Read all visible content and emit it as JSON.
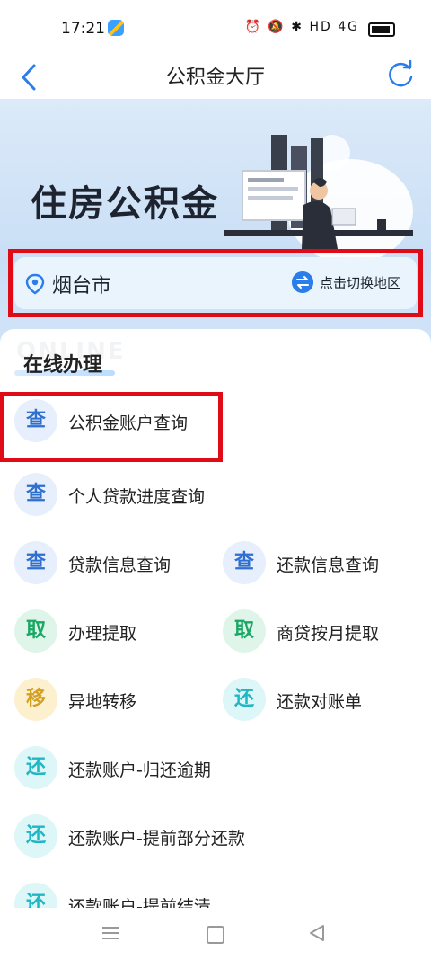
{
  "status_bar": {
    "time": "17:21",
    "icons": "⏰ 🔕 ✱ HD 4G"
  },
  "nav": {
    "title": "公积金大厅"
  },
  "banner": {
    "title": "住房公积金",
    "city": "烟台市",
    "switch_label": "点击切换地区"
  },
  "section": {
    "watermark": "ONLINE",
    "title": "在线办理"
  },
  "items": [
    {
      "icon": "查",
      "label": "公积金账户查询",
      "kind": "query"
    },
    {
      "icon": "查",
      "label": "个人贷款进度查询",
      "kind": "query"
    },
    {
      "icon": "查",
      "label": "贷款信息查询",
      "kind": "query"
    },
    {
      "icon": "查",
      "label": "还款信息查询",
      "kind": "query"
    },
    {
      "icon": "取",
      "label": "办理提取",
      "kind": "take"
    },
    {
      "icon": "取",
      "label": "商贷按月提取",
      "kind": "take"
    },
    {
      "icon": "移",
      "label": "异地转移",
      "kind": "move"
    },
    {
      "icon": "还",
      "label": "还款对账单",
      "kind": "repay"
    },
    {
      "icon": "还",
      "label": "还款账户-归还逾期",
      "kind": "repay"
    },
    {
      "icon": "还",
      "label": "还款账户-提前部分还款",
      "kind": "repay"
    },
    {
      "icon": "还",
      "label": "还款账户-提前结清",
      "kind": "repay"
    }
  ],
  "colors": {
    "accent": "#2b7de9",
    "highlight": "#e10b17"
  }
}
